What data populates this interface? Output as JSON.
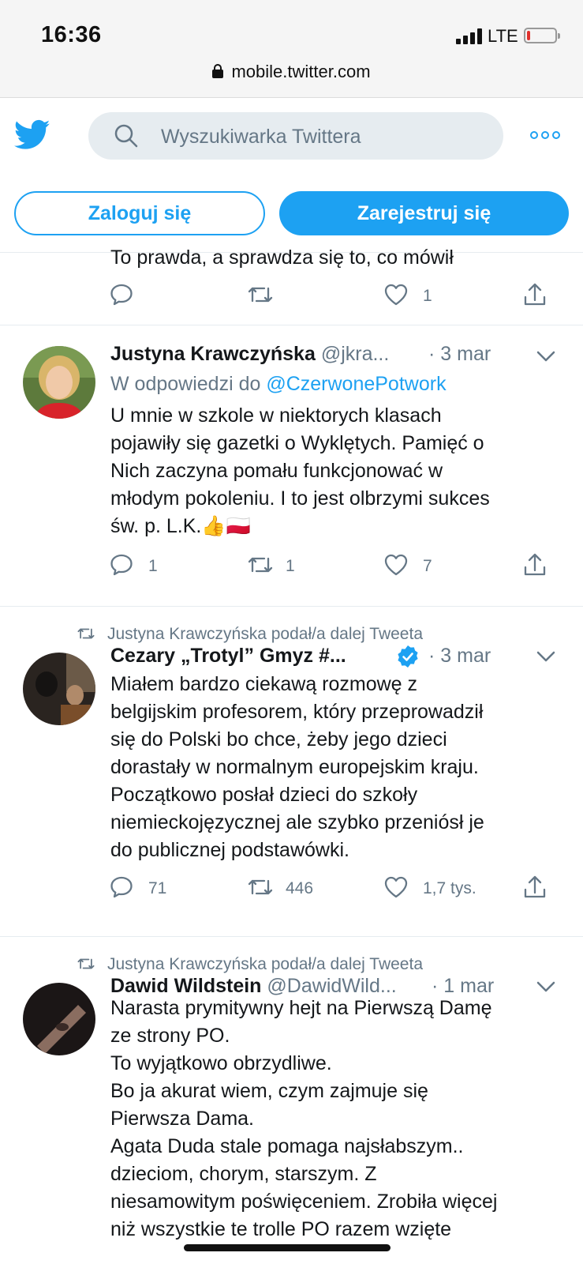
{
  "status_bar": {
    "time": "16:36",
    "network": "LTE",
    "url": "mobile.twitter.com"
  },
  "header": {
    "search_placeholder": "Wyszukiwarka Twittera",
    "login_label": "Zaloguj się",
    "signup_label": "Zarejestruj się",
    "accent_color": "#1da1f2"
  },
  "tweets": [
    {
      "text": "To prawda, a sprawdza się to, co mówił",
      "replies": "",
      "retweets": "",
      "likes": "1"
    },
    {
      "name": "Justyna Krawczyńska",
      "handle": "@jkra...",
      "date": "· 3 mar",
      "reply_prefix": "W odpowiedzi do ",
      "reply_mention": "@CzerwonePotwork",
      "text": "U mnie w szkole w niektorych klasach\npojawiły się gazetki o Wyklętych. Pamięć o\nNich zaczyna pomału funkcjonować w\nmłodym pokoleniu. I to jest olbrzymi sukces\nśw. p. L.K.👍🇵🇱",
      "replies": "1",
      "retweets": "1",
      "likes": "7"
    },
    {
      "retweet_note": "Justyna Krawczyńska podał/a dalej Tweeta",
      "name": "Cezary „Trotyl” Gmyz #...",
      "date": "· 3 mar",
      "verified": true,
      "text": "Miałem bardzo ciekawą rozmowę z\nbelgijskim profesorem, który przeprowadził\nsię do Polski bo chce, żeby jego dzieci\ndorastały w normalnym europejskim kraju.\nPoczątkowo posłał dzieci do szkoły\nniemieckojęzycznej ale szybko przeniósł je\ndo publicznej podstawówki.",
      "replies": "71",
      "retweets": "446",
      "likes": "1,7 tys."
    },
    {
      "retweet_note": "Justyna Krawczyńska podał/a dalej Tweeta",
      "name": "Dawid Wildstein",
      "handle": "@DawidWild...",
      "date": "· 1 mar",
      "text": "Narasta prymitywny hejt na Pierwszą Damę\nze strony PO.\nTo wyjątkowo obrzydliwe.\nBo ja akurat wiem, czym zajmuje się\nPierwsza Dama.\nAgata Duda stale pomaga najsłabszym..\ndzieciom, chorym, starszym. Z\nniesamowitym poświęceniem. Zrobiła więcej\nniż wszystkie te trolle PO razem wzięte"
    }
  ]
}
